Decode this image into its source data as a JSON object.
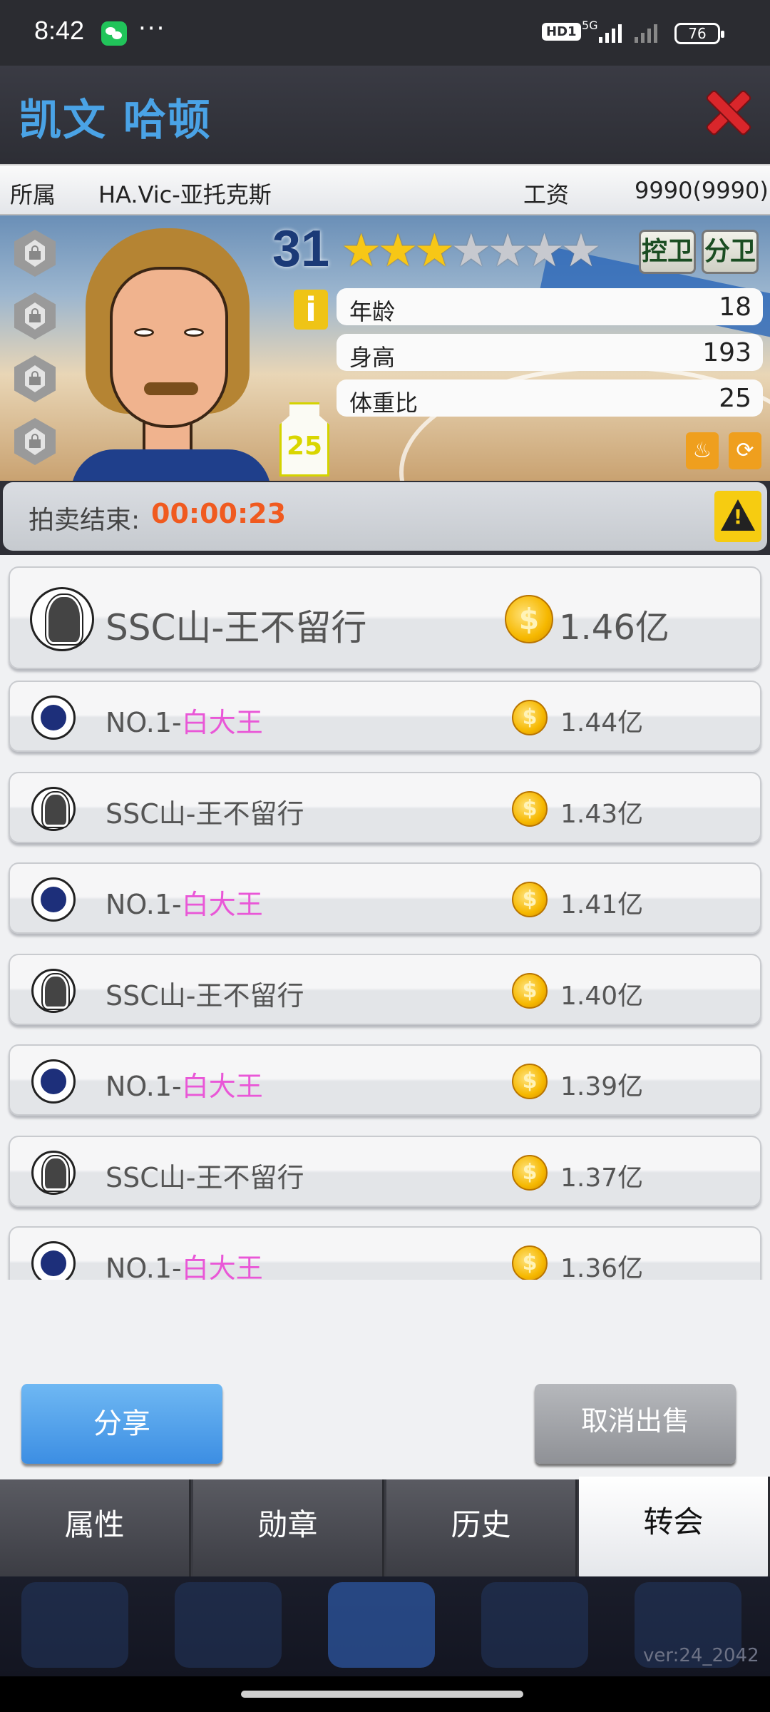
{
  "status_bar": {
    "time": "8:42",
    "dots": "···",
    "hd_label": "HD1",
    "network": "5G",
    "battery": "76"
  },
  "header": {
    "player_name": "凯文 哈顿"
  },
  "affiliation": {
    "label": "所属",
    "team": "HA.Vic-亚托克斯",
    "salary_label": "工资",
    "salary_value": "9990(9990)"
  },
  "player": {
    "rating": "31",
    "stars_filled": 3,
    "stars_total": 7,
    "positions": [
      "控卫",
      "分卫"
    ],
    "jersey_number": "25",
    "info_icon": "i",
    "stats": [
      {
        "label": "年龄",
        "value": "18"
      },
      {
        "label": "身高",
        "value": "193"
      },
      {
        "label": "体重比",
        "value": "25"
      }
    ]
  },
  "auction": {
    "label": "拍卖结束:",
    "countdown": "00:00:23"
  },
  "bids": [
    {
      "team_prefix": "SSC山-王不留行",
      "team_highlight": "",
      "amount": "1.46亿",
      "logo": "helmet-logo"
    },
    {
      "team_prefix": "NO.1-",
      "team_highlight": "白大王",
      "amount": "1.44亿",
      "logo": "blue-team-logo"
    },
    {
      "team_prefix": "SSC山-王不留行",
      "team_highlight": "",
      "amount": "1.43亿",
      "logo": "helmet-logo"
    },
    {
      "team_prefix": "NO.1-",
      "team_highlight": "白大王",
      "amount": "1.41亿",
      "logo": "blue-team-logo"
    },
    {
      "team_prefix": "SSC山-王不留行",
      "team_highlight": "",
      "amount": "1.40亿",
      "logo": "helmet-logo"
    },
    {
      "team_prefix": "NO.1-",
      "team_highlight": "白大王",
      "amount": "1.39亿",
      "logo": "blue-team-logo"
    },
    {
      "team_prefix": "SSC山-王不留行",
      "team_highlight": "",
      "amount": "1.37亿",
      "logo": "helmet-logo"
    },
    {
      "team_prefix": "NO.1-",
      "team_highlight": "白大王",
      "amount": "1.36亿",
      "logo": "blue-team-logo"
    }
  ],
  "actions": {
    "share": "分享",
    "cancel_sale": "取消出售"
  },
  "tabs": [
    {
      "label": "属性"
    },
    {
      "label": "勋章"
    },
    {
      "label": "历史"
    },
    {
      "label": "转会",
      "active": true
    }
  ],
  "version": "ver:24_2042",
  "colors": {
    "title_blue": "#4aa3e6",
    "timer_orange": "#f05a1f",
    "highlight_pink": "#e957d7",
    "close_red": "#d9262b"
  }
}
